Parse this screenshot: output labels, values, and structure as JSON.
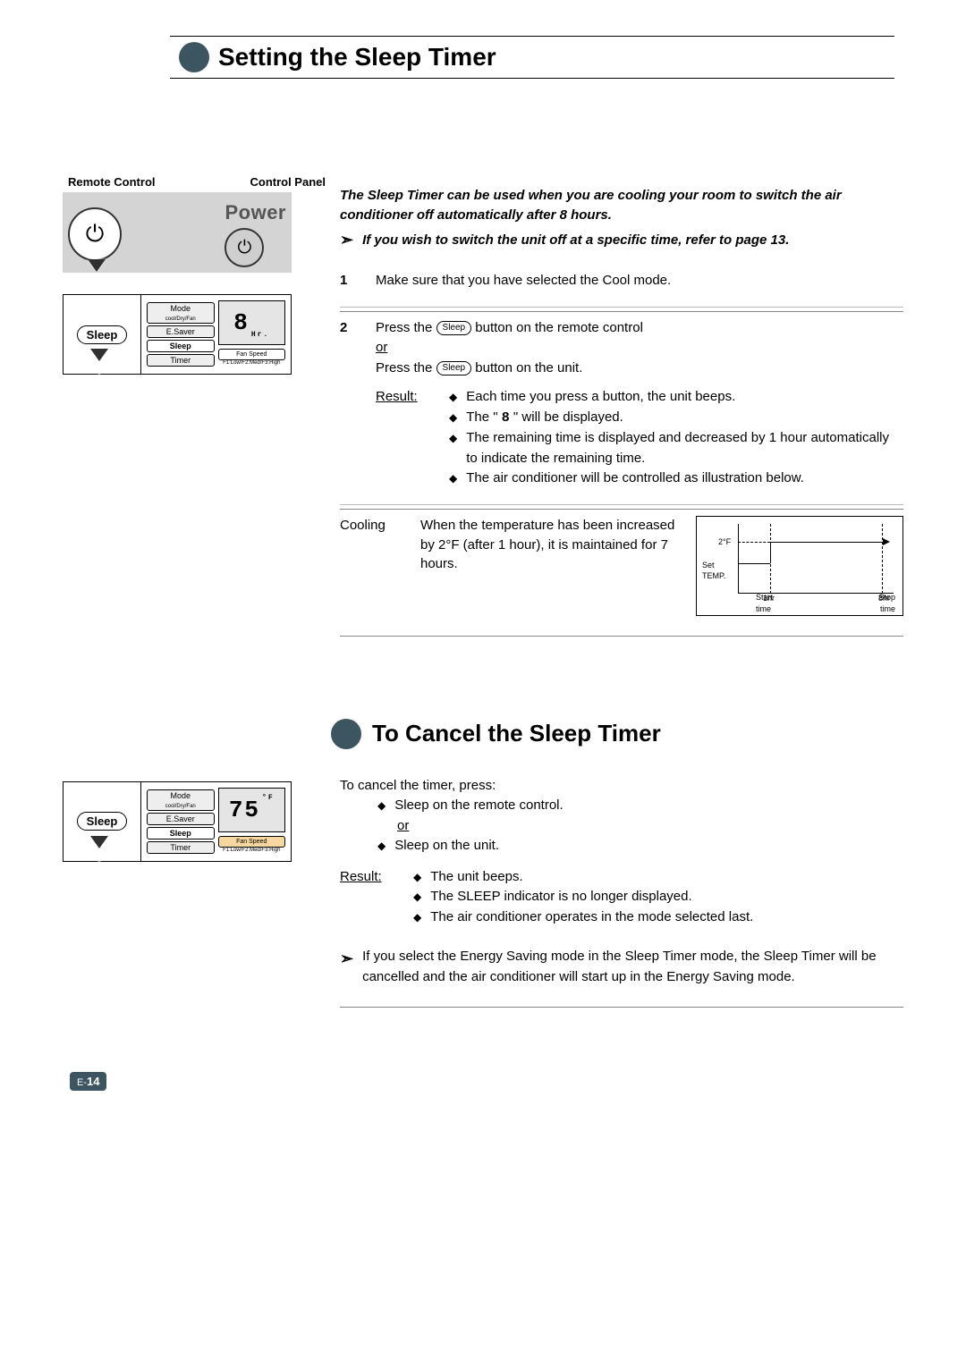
{
  "page_number_prefix": "E-",
  "page_number": "14",
  "section1": {
    "title": "Setting the Sleep Timer",
    "intro_p1": "The Sleep Timer can be used when you are cooling your room to switch the air conditioner off automatically after 8 hours.",
    "intro_note": "If you wish to switch the unit off at a specific time, refer to page 13.",
    "left": {
      "remote_head": "Remote Control",
      "panel_head": "Control Panel",
      "power_label": "Power",
      "sleep_label": "Sleep",
      "btn_mode": "Mode",
      "btn_mode_sub": "cool/Dry/Fan",
      "btn_esaver": "E.Saver",
      "btn_sleep": "Sleep",
      "btn_timer": "Timer",
      "btn_fanspeed": "Fan Speed",
      "fstrip": "F1:Low/F2:Med/F3:High",
      "display_value": "8",
      "display_unit": "Hr."
    },
    "step1_num": "1",
    "step1_text": "Make sure that you have selected the Cool mode.",
    "step2_num": "2",
    "step2_a": "Press the ",
    "step2_sleep_pill": "Sleep",
    "step2_b": " button on the remote control",
    "step2_or": "or",
    "step2_c": "Press the ",
    "step2_d": " button on the unit.",
    "result_label": "Result:",
    "r1": "Each time you press a button, the unit beeps.",
    "r2a": "The \" ",
    "r2_sym": "8",
    "r2b": " \" will be displayed.",
    "r3": "The remaining time is displayed and decreased by 1 hour automatically to indicate the remaining time.",
    "r4": "The air conditioner will be controlled as illustration below.",
    "cooling_label": "Cooling",
    "cooling_text": "When the temperature has been increased by 2°F (after 1 hour), it is maintained for 7 hours."
  },
  "chart_data": {
    "type": "line",
    "title": "",
    "xlabel": "",
    "ylabel": "Set TEMP.",
    "annotations": {
      "delta_label": "2°F",
      "x_start_top": "Start",
      "x_start_bot": "time",
      "x_end_top": "Stop",
      "x_end_bot": "time",
      "tick1": "1hr",
      "tick2": "8hr"
    },
    "series": [
      {
        "name": "SetTemp",
        "x": [
          0,
          1,
          1,
          8
        ],
        "y": [
          0,
          0,
          2,
          2
        ]
      }
    ],
    "xlim": [
      0,
      8
    ],
    "ylim": [
      0,
      3
    ]
  },
  "section2": {
    "title": "To Cancel the Sleep Timer",
    "left": {
      "sleep_label": "Sleep",
      "btn_mode": "Mode",
      "btn_mode_sub": "cool/Dry/Fan",
      "btn_esaver": "E.Saver",
      "btn_sleep": "Sleep",
      "btn_timer": "Timer",
      "btn_fanspeed": "Fan Speed",
      "fstrip": "F1:Low/F2:Med/F3:High",
      "display_value": "75",
      "display_unit": "°F"
    },
    "lead": "To cancel the timer, press:",
    "a1": "Sleep on the remote control.",
    "a_or": "or",
    "a2": "Sleep on the unit.",
    "result_label": "Result:",
    "r1": "The unit beeps.",
    "r2": "The SLEEP indicator is no longer displayed.",
    "r3": "The air conditioner operates in the mode selected last.",
    "note": "If you select the Energy Saving mode in the Sleep Timer mode, the Sleep Timer will be cancelled and the air conditioner will start up in the Energy Saving mode."
  }
}
